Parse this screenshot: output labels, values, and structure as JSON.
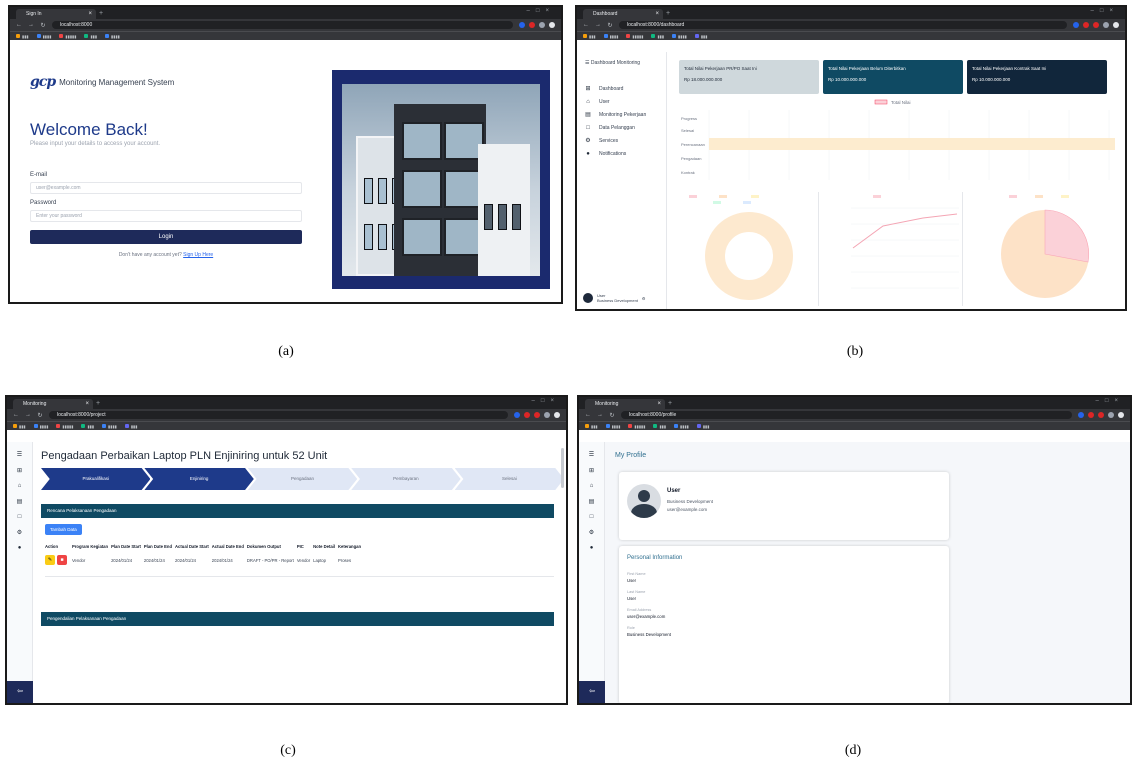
{
  "captions": [
    "(a)",
    "(b)",
    "(c)",
    "(d)"
  ],
  "login": {
    "browser": {
      "tab": "Sign In",
      "url": "localhost:8000"
    },
    "brand": "Monitoring Management System",
    "logo_text": "gcp",
    "welcome": "Welcome Back!",
    "welcome_sub": "Please input your details to access your account.",
    "email_label": "E-mail",
    "email_placeholder": "user@example.com",
    "password_label": "Password",
    "password_placeholder": "Enter your password",
    "login_button": "Login",
    "signup_text": "Don't have any account yet?",
    "signup_link": "Sign Up Here"
  },
  "dashboard": {
    "browser": {
      "tab": "Dashboard",
      "url": "localhost:8000/dashboard"
    },
    "brand": "Dashboard Monitoring",
    "menu": [
      {
        "icon": "⊞",
        "label": "Dashboard"
      },
      {
        "icon": "⌂",
        "label": "User"
      },
      {
        "icon": "▤",
        "label": "Monitoring Pekerjaan"
      },
      {
        "icon": "□",
        "label": "Data Pelanggan"
      },
      {
        "icon": "⚙",
        "label": "Services"
      },
      {
        "icon": "●",
        "label": "Notifications"
      }
    ],
    "user_name": "User",
    "user_role": "Business Development",
    "cards": [
      {
        "title": "Total Nilai Pekerjaan PR/PO Saat Ini",
        "value": "Rp 18.000.000.000",
        "bg": "#cfd8dc",
        "fg": "#1f2937"
      },
      {
        "title": "Total Nilai Pekerjaan Belum Diterbitkan",
        "value": "Rp 10.000.000.000",
        "bg": "#0f4a63",
        "fg": "#ffffff"
      },
      {
        "title": "Total Nilai Pekerjaan Kontrak Saat Ini",
        "value": "Rp 10.000.000.000",
        "bg": "#11263b",
        "fg": "#ffffff"
      }
    ],
    "bar_legend": "Total Nilai",
    "bar_categories": [
      "Progress",
      "Selesai",
      "Perencanaan",
      "Pengadaan",
      "Kontrak"
    ]
  },
  "project": {
    "browser": {
      "tab": "Monitoring",
      "url": "localhost:8000/project"
    },
    "title": "Pengadaan Perbaikan Laptop PLN Enjiniring untuk 52 Unit",
    "steps": [
      "Prakualifikasi",
      "Enjiniring",
      "Pengadaan",
      "Pembayaran",
      "Selesai"
    ],
    "section_1": "Rencana Pelaksanaan Pengadaan",
    "add_button": "Tambah Data",
    "columns": [
      "Action",
      "Program Kegiatan",
      "Plan Date Start",
      "Plan Date End",
      "Actual Date Start",
      "Actual Date End",
      "Dokumen Output",
      "PIC",
      "Note Detail",
      "Keterangan"
    ],
    "row": {
      "program": "Vendor",
      "plan_start": "2024/01/24",
      "plan_end": "2024/01/24",
      "actual_start": "2024/01/24",
      "actual_end": "2024/01/24",
      "dokumen": "DRAFT - PO/PR - Report",
      "pic": "Vendor",
      "note": "Laptop",
      "ket": "Proses"
    },
    "section_2": "Pengendalian Pelaksanaan Pengadaan"
  },
  "profile": {
    "browser": {
      "tab": "Monitoring",
      "url": "localhost:8000/profile"
    },
    "title": "My Profile",
    "name": "User",
    "role": "Business Development",
    "email": "user@example.com",
    "section": "Personal Information",
    "fields": [
      {
        "label": "First Name",
        "value": "User"
      },
      {
        "label": "Last Name",
        "value": "User"
      },
      {
        "label": "Email Address",
        "value": "user@example.com"
      },
      {
        "label": "Role",
        "value": "Business Development"
      }
    ]
  },
  "colors": {
    "navy": "#1e2a5a",
    "teal": "#0f4a63",
    "pie_pink": "#fbd1d8",
    "pie_peach": "#fde2c7"
  }
}
